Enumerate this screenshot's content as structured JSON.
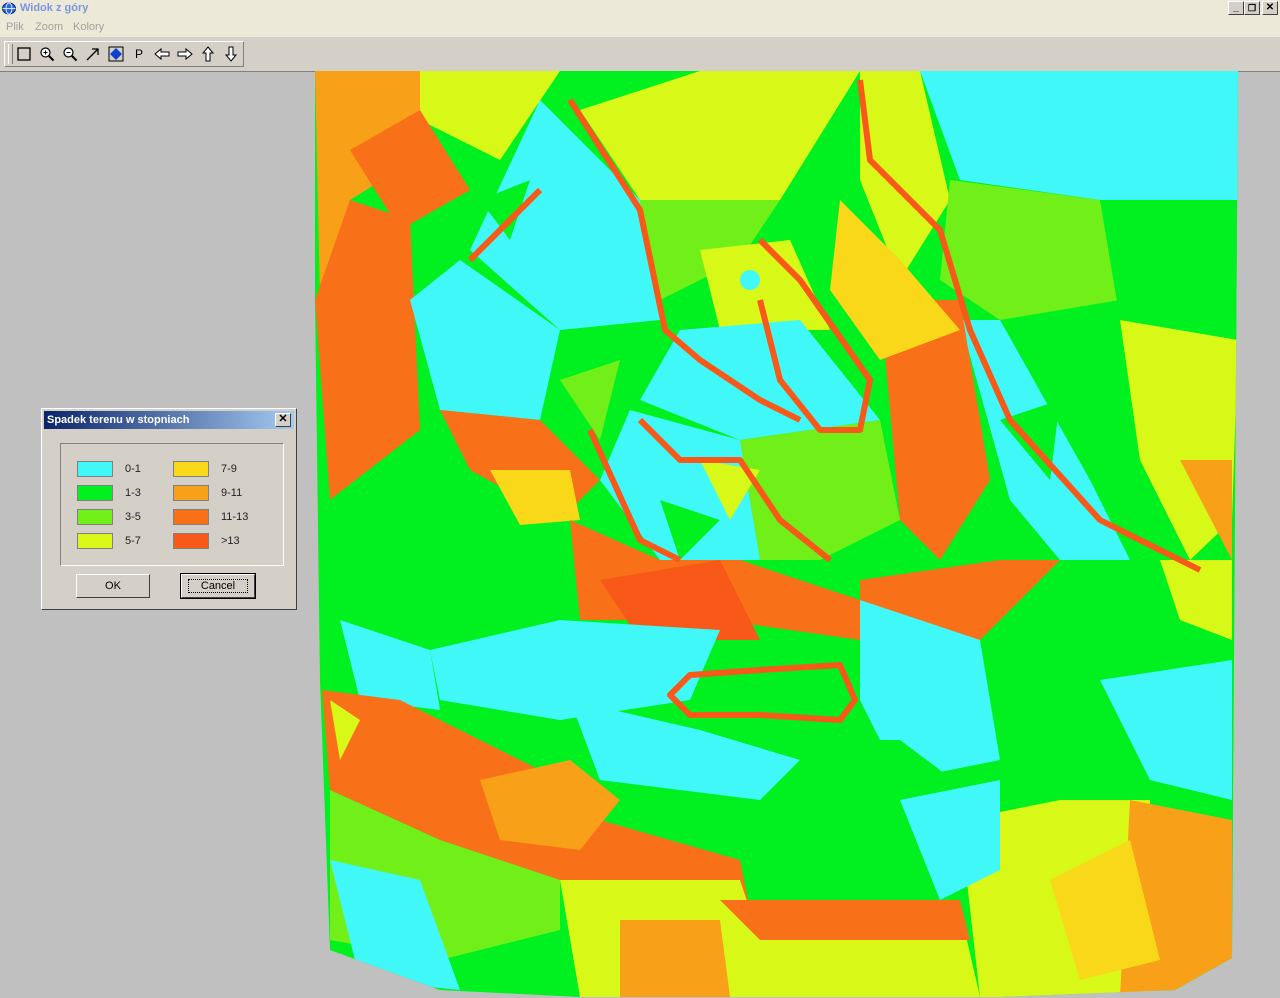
{
  "window": {
    "title": "Widok z góry"
  },
  "menu": [
    "Plik",
    "Zoom",
    "Kolory"
  ],
  "toolbar": [
    {
      "name": "select-rect-icon"
    },
    {
      "name": "zoom-in-icon"
    },
    {
      "name": "zoom-out-icon"
    },
    {
      "name": "arrow-icon"
    },
    {
      "name": "fill-view-icon"
    },
    {
      "name": "p-tool-icon",
      "label": "P"
    },
    {
      "name": "pan-left-icon"
    },
    {
      "name": "pan-right-icon"
    },
    {
      "name": "pan-up-icon"
    },
    {
      "name": "pan-down-icon"
    }
  ],
  "dialog": {
    "title": "Spadek terenu w stopniach",
    "ok_label": "OK",
    "cancel_label": "Cancel",
    "legend": [
      {
        "label": "0-1",
        "color": "#40f8f8"
      },
      {
        "label": "1-3",
        "color": "#00f020"
      },
      {
        "label": "3-5",
        "color": "#70f018"
      },
      {
        "label": "5-7",
        "color": "#d8f818"
      },
      {
        "label": "7-9",
        "color": "#f8d818"
      },
      {
        "label": "9-11",
        "color": "#f8a018"
      },
      {
        "label": "11-13",
        "color": "#f87018"
      },
      {
        "label": ">13",
        "color": "#f85818"
      }
    ]
  }
}
